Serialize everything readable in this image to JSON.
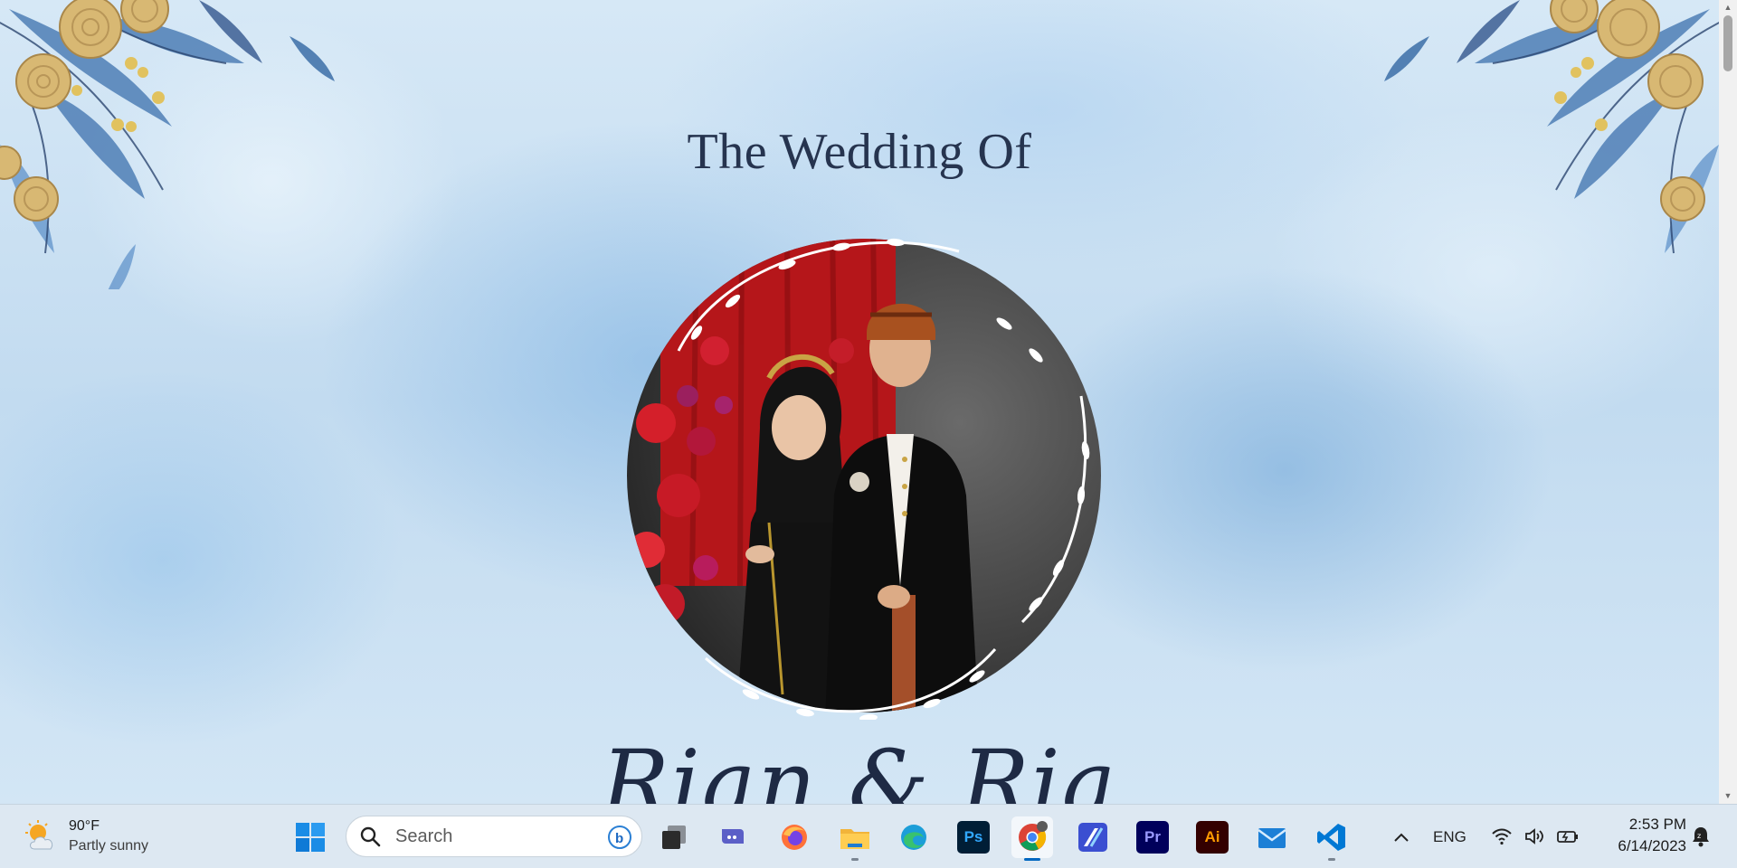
{
  "page": {
    "heading": "The Wedding Of",
    "couple_names": "Rian & Ria"
  },
  "taskbar": {
    "weather": {
      "temp": "90°F",
      "desc": "Partly sunny",
      "icon": "partly-sunny-icon"
    },
    "search": {
      "placeholder": "Search"
    },
    "apps": [
      {
        "name": "start-button",
        "icon": "windows-icon"
      },
      {
        "name": "task-view",
        "icon": "task-view-icon"
      },
      {
        "name": "zoom-app",
        "icon": "zoom-icon"
      },
      {
        "name": "firefox-app",
        "icon": "firefox-icon"
      },
      {
        "name": "file-explorer-app",
        "icon": "folder-icon"
      },
      {
        "name": "edge-app",
        "icon": "edge-icon"
      },
      {
        "name": "photoshop-app",
        "icon": "photoshop-icon",
        "label": "Ps"
      },
      {
        "name": "chrome-app",
        "icon": "chrome-icon"
      },
      {
        "name": "affinity-app",
        "icon": "affinity-icon"
      },
      {
        "name": "premiere-app",
        "icon": "premiere-icon",
        "label": "Pr"
      },
      {
        "name": "illustrator-app",
        "icon": "illustrator-icon",
        "label": "Ai"
      },
      {
        "name": "mail-app",
        "icon": "mail-icon"
      },
      {
        "name": "vscode-app",
        "icon": "vscode-icon"
      }
    ],
    "tray": {
      "language": "ENG",
      "time": "2:53 PM",
      "date": "6/14/2023"
    }
  },
  "colors": {
    "heading": "#26344f",
    "taskbar_bg": "#dde8f2",
    "page_bg": "#c2dbf0"
  }
}
